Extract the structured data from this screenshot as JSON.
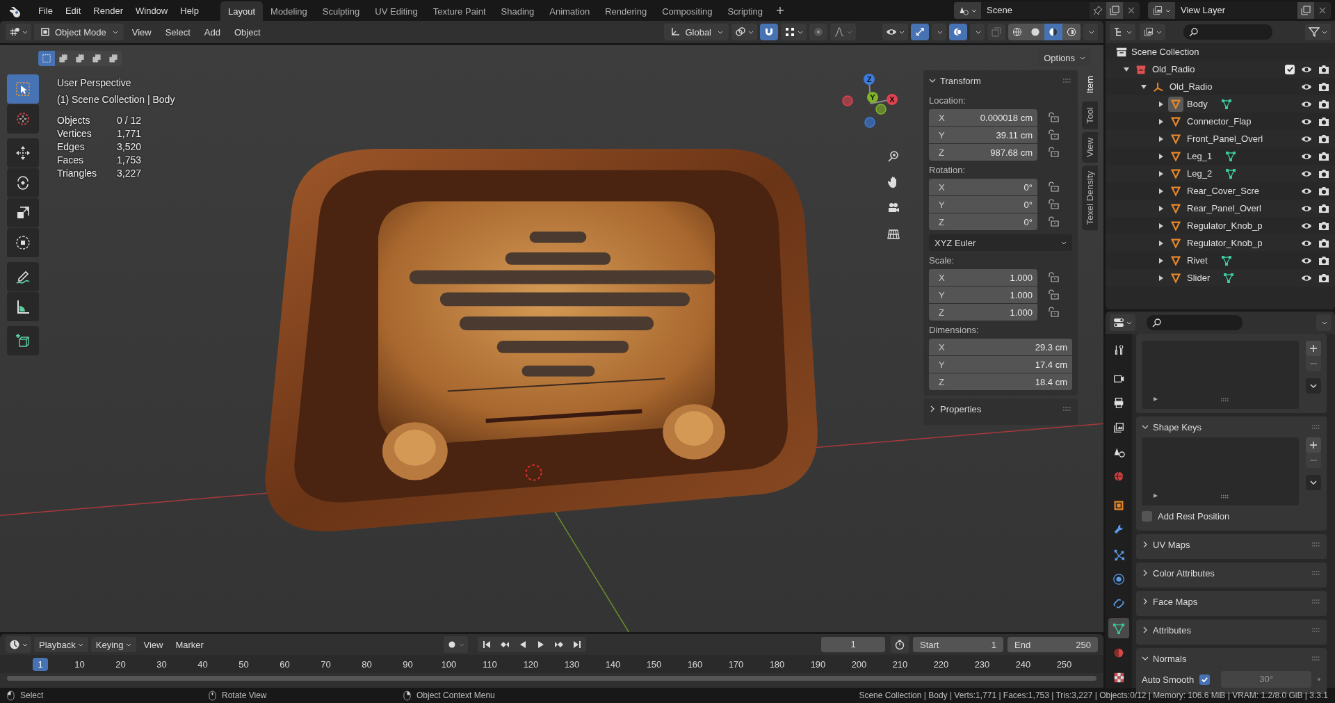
{
  "menu": [
    {
      "label": "File"
    },
    {
      "label": "Edit"
    },
    {
      "label": "Render"
    },
    {
      "label": "Window"
    },
    {
      "label": "Help"
    }
  ],
  "workspaces": [
    {
      "label": "Layout",
      "selected": true
    },
    {
      "label": "Modeling",
      "selected": false
    },
    {
      "label": "Sculpting",
      "selected": false
    },
    {
      "label": "UV Editing",
      "selected": false
    },
    {
      "label": "Texture Paint",
      "selected": false
    },
    {
      "label": "Shading",
      "selected": false
    },
    {
      "label": "Animation",
      "selected": false
    },
    {
      "label": "Rendering",
      "selected": false
    },
    {
      "label": "Compositing",
      "selected": false
    },
    {
      "label": "Scripting",
      "selected": false
    }
  ],
  "scene": "Scene",
  "view_layer": "View Layer",
  "viewport": {
    "mode": "Object Mode",
    "menus": [
      "View",
      "Select",
      "Add",
      "Object"
    ],
    "orientation": "Global",
    "options": "Options",
    "select_modes": [
      {
        "selected": true
      },
      {
        "selected": false
      },
      {
        "selected": false
      },
      {
        "selected": false
      },
      {
        "selected": false
      }
    ],
    "snap_on": true,
    "gizmos_on": true,
    "overlays_on": true,
    "xray_on": false,
    "shading": [
      {
        "kind": "wireframe",
        "selected": false
      },
      {
        "kind": "solid",
        "selected": false
      },
      {
        "kind": "material",
        "selected": true
      },
      {
        "kind": "rendered",
        "selected": false
      }
    ],
    "tools": [
      {
        "kind": "select_box",
        "selected": true
      },
      {
        "kind": "cursor",
        "selected": false
      },
      {
        "kind": "move",
        "selected": false
      },
      {
        "kind": "rotate",
        "selected": false
      },
      {
        "kind": "scale",
        "selected": false
      },
      {
        "kind": "transform",
        "selected": false
      },
      {
        "kind": "annotate",
        "selected": false
      },
      {
        "kind": "measure",
        "selected": false
      },
      {
        "kind": "add_cube",
        "selected": false
      }
    ],
    "info": [
      "User Perspective",
      "(1) Scene Collection | Body"
    ],
    "stats": [
      {
        "label": "Objects",
        "value": "0 / 12"
      },
      {
        "label": "Vertices",
        "value": "1,771"
      },
      {
        "label": "Edges",
        "value": "3,520"
      },
      {
        "label": "Faces",
        "value": "1,753"
      },
      {
        "label": "Triangles",
        "value": "3,227"
      }
    ],
    "gizmo_axes": [
      {
        "label": "X",
        "color": "#e0424f"
      },
      {
        "label": "Y",
        "color": "#7fb429"
      },
      {
        "label": "Z",
        "color": "#3a7ce0"
      }
    ]
  },
  "sidebar": {
    "tabs": [
      {
        "label": "Item",
        "selected": true
      },
      {
        "label": "Tool",
        "selected": false
      },
      {
        "label": "View",
        "selected": false
      },
      {
        "label": "Texel Density",
        "selected": false
      }
    ],
    "transform": {
      "title": "Transform",
      "expanded": true,
      "groups": [
        {
          "label": "Location:",
          "fields": [
            {
              "axis": "X",
              "value": "0.000018 cm",
              "locked": false
            },
            {
              "axis": "Y",
              "value": "39.11 cm",
              "locked": false
            },
            {
              "axis": "Z",
              "value": "987.68 cm",
              "locked": false
            }
          ]
        },
        {
          "label": "Rotation:",
          "fields": [
            {
              "axis": "X",
              "value": "0°",
              "locked": false
            },
            {
              "axis": "Y",
              "value": "0°",
              "locked": false
            },
            {
              "axis": "Z",
              "value": "0°",
              "locked": false
            }
          ],
          "mode": "XYZ Euler"
        },
        {
          "label": "Scale:",
          "fields": [
            {
              "axis": "X",
              "value": "1.000",
              "locked": false
            },
            {
              "axis": "Y",
              "value": "1.000",
              "locked": false
            },
            {
              "axis": "Z",
              "value": "1.000",
              "locked": false
            }
          ]
        },
        {
          "label": "Dimensions:",
          "fields": [
            {
              "axis": "X",
              "value": "29.3 cm"
            },
            {
              "axis": "Y",
              "value": "17.4 cm"
            },
            {
              "axis": "Z",
              "value": "18.4 cm"
            }
          ]
        }
      ]
    },
    "properties": {
      "title": "Properties",
      "expanded": false
    }
  },
  "outliner": {
    "root": "Scene Collection",
    "items": [
      {
        "name": "Old_Radio",
        "kind": "collection",
        "checked": true,
        "expanded": true,
        "selected": false,
        "children": [
          {
            "name": "Old_Radio",
            "kind": "empty",
            "expanded": true,
            "selected": false,
            "children": [
              {
                "name": "Body",
                "kind": "mesh",
                "expanded": false,
                "selected": true,
                "mesh_data": true
              },
              {
                "name": "Connector_Flap",
                "kind": "mesh",
                "expanded": false,
                "selected": false,
                "mesh_data": false
              },
              {
                "name": "Front_Panel_Overl",
                "kind": "mesh",
                "expanded": false,
                "selected": false,
                "mesh_data": false
              },
              {
                "name": "Leg_1",
                "kind": "mesh",
                "expanded": false,
                "selected": false,
                "mesh_data": true
              },
              {
                "name": "Leg_2",
                "kind": "mesh",
                "expanded": false,
                "selected": false,
                "mesh_data": true
              },
              {
                "name": "Rear_Cover_Scre",
                "kind": "mesh",
                "expanded": false,
                "selected": false,
                "mesh_data": false
              },
              {
                "name": "Rear_Panel_Overl",
                "kind": "mesh",
                "expanded": false,
                "selected": false,
                "mesh_data": false
              },
              {
                "name": "Regulator_Knob_p",
                "kind": "mesh",
                "expanded": false,
                "selected": false,
                "mesh_data": false
              },
              {
                "name": "Regulator_Knob_p",
                "kind": "mesh",
                "expanded": false,
                "selected": false,
                "mesh_data": false
              },
              {
                "name": "Rivet",
                "kind": "mesh",
                "expanded": false,
                "selected": false,
                "mesh_data": true
              },
              {
                "name": "Slider",
                "kind": "mesh",
                "expanded": false,
                "selected": false,
                "mesh_data": true
              }
            ]
          }
        ]
      }
    ]
  },
  "properties": {
    "tabs": [
      {
        "kind": "tool",
        "selected": false
      },
      {
        "kind": "render",
        "selected": false
      },
      {
        "kind": "output",
        "selected": false
      },
      {
        "kind": "view_layer",
        "selected": false
      },
      {
        "kind": "scene",
        "selected": false
      },
      {
        "kind": "world",
        "selected": false
      },
      {
        "kind": "object",
        "selected": false
      },
      {
        "kind": "modifiers",
        "selected": false
      },
      {
        "kind": "particles",
        "selected": false
      },
      {
        "kind": "physics",
        "selected": false
      },
      {
        "kind": "constraints",
        "selected": false
      },
      {
        "kind": "data",
        "selected": true
      },
      {
        "kind": "material",
        "selected": false
      },
      {
        "kind": "texture",
        "selected": false
      }
    ],
    "panels": [
      {
        "list": true
      },
      {
        "title": "Shape Keys",
        "expanded": true,
        "list": true,
        "checkbox": {
          "label": "Add Rest Position",
          "checked": false
        }
      },
      {
        "title": "UV Maps",
        "expanded": false
      },
      {
        "title": "Color Attributes",
        "expanded": false
      },
      {
        "title": "Face Maps",
        "expanded": false
      },
      {
        "title": "Attributes",
        "expanded": false
      },
      {
        "title": "Normals",
        "expanded": true,
        "checkbox": {
          "label": "Auto Smooth",
          "checked": true,
          "angle": "30°"
        }
      }
    ]
  },
  "timeline": {
    "menus": [
      {
        "label": "Playback",
        "dropdown": true
      },
      {
        "label": "Keying",
        "dropdown": true
      },
      {
        "label": "View",
        "dropdown": false
      },
      {
        "label": "Marker",
        "dropdown": false
      }
    ],
    "current_frame": "1",
    "start": {
      "label": "Start",
      "value": "1"
    },
    "end": {
      "label": "End",
      "value": "250"
    },
    "ruler": [
      {
        "label": "1",
        "current": true
      },
      {
        "label": "10",
        "current": false
      },
      {
        "label": "20",
        "current": false
      },
      {
        "label": "30",
        "current": false
      },
      {
        "label": "40",
        "current": false
      },
      {
        "label": "50",
        "current": false
      },
      {
        "label": "60",
        "current": false
      },
      {
        "label": "70",
        "current": false
      },
      {
        "label": "80",
        "current": false
      },
      {
        "label": "90",
        "current": false
      },
      {
        "label": "100",
        "current": false
      },
      {
        "label": "110",
        "current": false
      },
      {
        "label": "120",
        "current": false
      },
      {
        "label": "130",
        "current": false
      },
      {
        "label": "140",
        "current": false
      },
      {
        "label": "150",
        "current": false
      },
      {
        "label": "160",
        "current": false
      },
      {
        "label": "170",
        "current": false
      },
      {
        "label": "180",
        "current": false
      },
      {
        "label": "190",
        "current": false
      },
      {
        "label": "200",
        "current": false
      },
      {
        "label": "210",
        "current": false
      },
      {
        "label": "220",
        "current": false
      },
      {
        "label": "230",
        "current": false
      },
      {
        "label": "240",
        "current": false
      },
      {
        "label": "250",
        "current": false
      }
    ]
  },
  "status": {
    "hints": [
      {
        "kind": "left",
        "label": "Select"
      },
      {
        "kind": "middle",
        "label": "Rotate View"
      },
      {
        "kind": "right",
        "label": "Object Context Menu"
      }
    ],
    "info": "Scene Collection | Body | Verts:1,771 | Faces:1,753 | Tris:3,227 | Objects:0/12 | Memory: 106.6 MiB | VRAM: 1.2/8.0 GiB | 3.3.1"
  }
}
